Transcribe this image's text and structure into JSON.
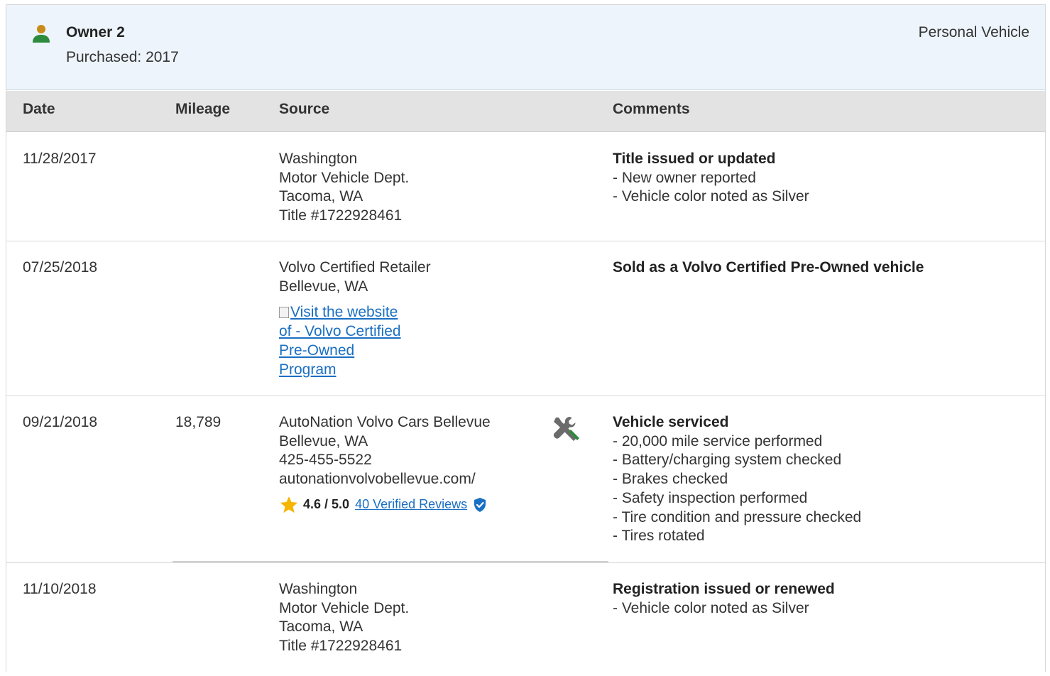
{
  "owner": {
    "name": "Owner 2",
    "purchased": "Purchased: 2017",
    "type": "Personal Vehicle",
    "icon": "person-icon"
  },
  "columns": {
    "date": "Date",
    "mileage": "Mileage",
    "source": "Source",
    "comments": "Comments"
  },
  "rows": [
    {
      "date": "11/28/2017",
      "mileage": "",
      "source": [
        "Washington",
        "Motor Vehicle Dept.",
        "Tacoma, WA",
        "Title #1722928461"
      ],
      "comment_title": "Title issued or updated",
      "comment_items": [
        "- New owner reported",
        "- Vehicle color noted as Silver"
      ]
    },
    {
      "date": "07/25/2018",
      "mileage": "",
      "source": [
        "Volvo Certified Retailer",
        "Bellevue, WA"
      ],
      "source_link": "Visit the website of - Volvo Certified Pre-Owned Program",
      "comment_title": "Sold as a Volvo Certified Pre-Owned vehicle",
      "comment_items": []
    },
    {
      "date": "09/21/2018",
      "mileage": "18,789",
      "source": [
        "AutoNation Volvo Cars Bellevue",
        "Bellevue, WA",
        "425-455-5522",
        "autonationvolvobellevue.com/"
      ],
      "rating": {
        "score": "4.6 / 5.0",
        "reviews": "40 Verified Reviews"
      },
      "comment_title": "Vehicle serviced",
      "comment_items": [
        "- 20,000 mile service performed",
        "- Battery/charging system checked",
        "- Brakes checked",
        "- Safety inspection performed",
        "- Tire condition and pressure checked",
        "- Tires rotated"
      ]
    },
    {
      "date": "11/10/2018",
      "mileage": "",
      "source": [
        "Washington",
        "Motor Vehicle Dept.",
        "Tacoma, WA",
        "Title #1722928461"
      ],
      "comment_title": "Registration issued or renewed",
      "comment_items": [
        "- Vehicle color noted as Silver"
      ]
    }
  ],
  "colors": {
    "header_bg": "#edf4fb",
    "column_header_bg": "#e3e3e3",
    "link": "#1a6fc2",
    "owner_icon": "#2e8b3d",
    "star": "#f6b500",
    "verified": "#1a6fc2"
  }
}
